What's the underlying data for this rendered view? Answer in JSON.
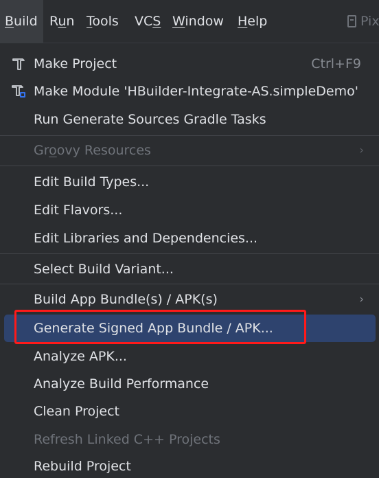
{
  "menubar": {
    "items": [
      {
        "mnemonic": "B",
        "rest": "uild"
      },
      {
        "pre": "R",
        "mnemonic": "u",
        "rest": "n"
      },
      {
        "mnemonic": "T",
        "rest": "ools"
      },
      {
        "pre": "VC",
        "mnemonic": "S",
        "rest": ""
      },
      {
        "mnemonic": "W",
        "rest": "indow"
      },
      {
        "mnemonic": "H",
        "rest": "elp"
      }
    ],
    "pix_label": "Pix"
  },
  "build_menu": {
    "make_project": {
      "label": "Make Project",
      "shortcut": "Ctrl+F9",
      "icon": "hammer-icon"
    },
    "make_module": {
      "label": "Make Module 'HBuilder-Integrate-AS.simpleDemo'",
      "icon": "hammer-module-icon"
    },
    "run_generate": {
      "label": "Run Generate Sources Gradle Tasks"
    },
    "groovy": {
      "pre": "Gr",
      "mnemonic": "o",
      "rest": "ovy Resources",
      "disabled": true
    },
    "edit_build_types": {
      "label": "Edit Build Types..."
    },
    "edit_flavors": {
      "label": "Edit Flavors..."
    },
    "edit_libraries": {
      "label": "Edit Libraries and Dependencies..."
    },
    "select_variant": {
      "label": "Select Build Variant..."
    },
    "build_bundle": {
      "label": "Build App Bundle(s) / APK(s)"
    },
    "generate_signed": {
      "label": "Generate Signed App Bundle / APK...",
      "highlighted": true
    },
    "analyze_apk": {
      "label": "Analyze APK..."
    },
    "analyze_perf": {
      "label": "Analyze Build Performance"
    },
    "clean_project": {
      "label": "Clean Project"
    },
    "refresh_cpp": {
      "label": "Refresh Linked C++ Projects",
      "disabled": true
    },
    "rebuild_project": {
      "label": "Rebuild Project"
    }
  },
  "colors": {
    "background": "#2b2d30",
    "highlight": "#2e436e",
    "annotation_box": "#ff1a1a",
    "text": "#dfe1e5",
    "disabled_text": "#6f737a"
  }
}
